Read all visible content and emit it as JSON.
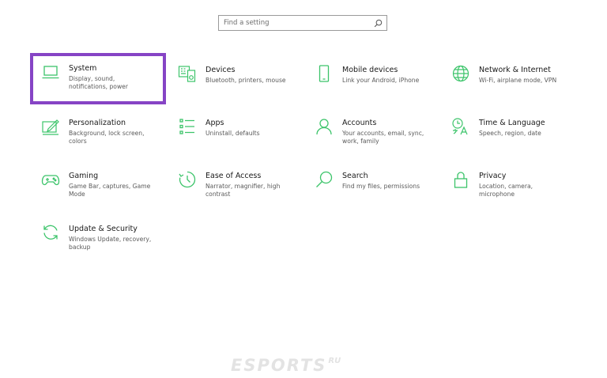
{
  "search": {
    "placeholder": "Find a setting",
    "value": ""
  },
  "accent": "#3cc46a",
  "selection_color": "#8644c5",
  "tiles": [
    {
      "title": "System",
      "desc": "Display, sound, notifications, power",
      "icon": "laptop-icon"
    },
    {
      "title": "Devices",
      "desc": "Bluetooth, printers, mouse",
      "icon": "devices-icon"
    },
    {
      "title": "Mobile devices",
      "desc": "Link your Android, iPhone",
      "icon": "phone-icon"
    },
    {
      "title": "Network & Internet",
      "desc": "Wi-Fi, airplane mode, VPN",
      "icon": "globe-icon"
    },
    {
      "title": "Personalization",
      "desc": "Background, lock screen, colors",
      "icon": "paint-icon"
    },
    {
      "title": "Apps",
      "desc": "Uninstall, defaults",
      "icon": "apps-list-icon"
    },
    {
      "title": "Accounts",
      "desc": "Your accounts, email, sync, work, family",
      "icon": "person-icon"
    },
    {
      "title": "Time & Language",
      "desc": "Speech, region, date",
      "icon": "time-language-icon"
    },
    {
      "title": "Gaming",
      "desc": "Game Bar, captures, Game Mode",
      "icon": "gamepad-icon"
    },
    {
      "title": "Ease of Access",
      "desc": "Narrator, magnifier, high contrast",
      "icon": "ease-of-access-icon"
    },
    {
      "title": "Search",
      "desc": "Find my files, permissions",
      "icon": "search-icon"
    },
    {
      "title": "Privacy",
      "desc": "Location, camera, microphone",
      "icon": "lock-icon"
    },
    {
      "title": "Update & Security",
      "desc": "Windows Update, recovery, backup",
      "icon": "update-icon"
    }
  ],
  "watermark": {
    "main": "ESPORTS",
    "sub": "RU"
  }
}
